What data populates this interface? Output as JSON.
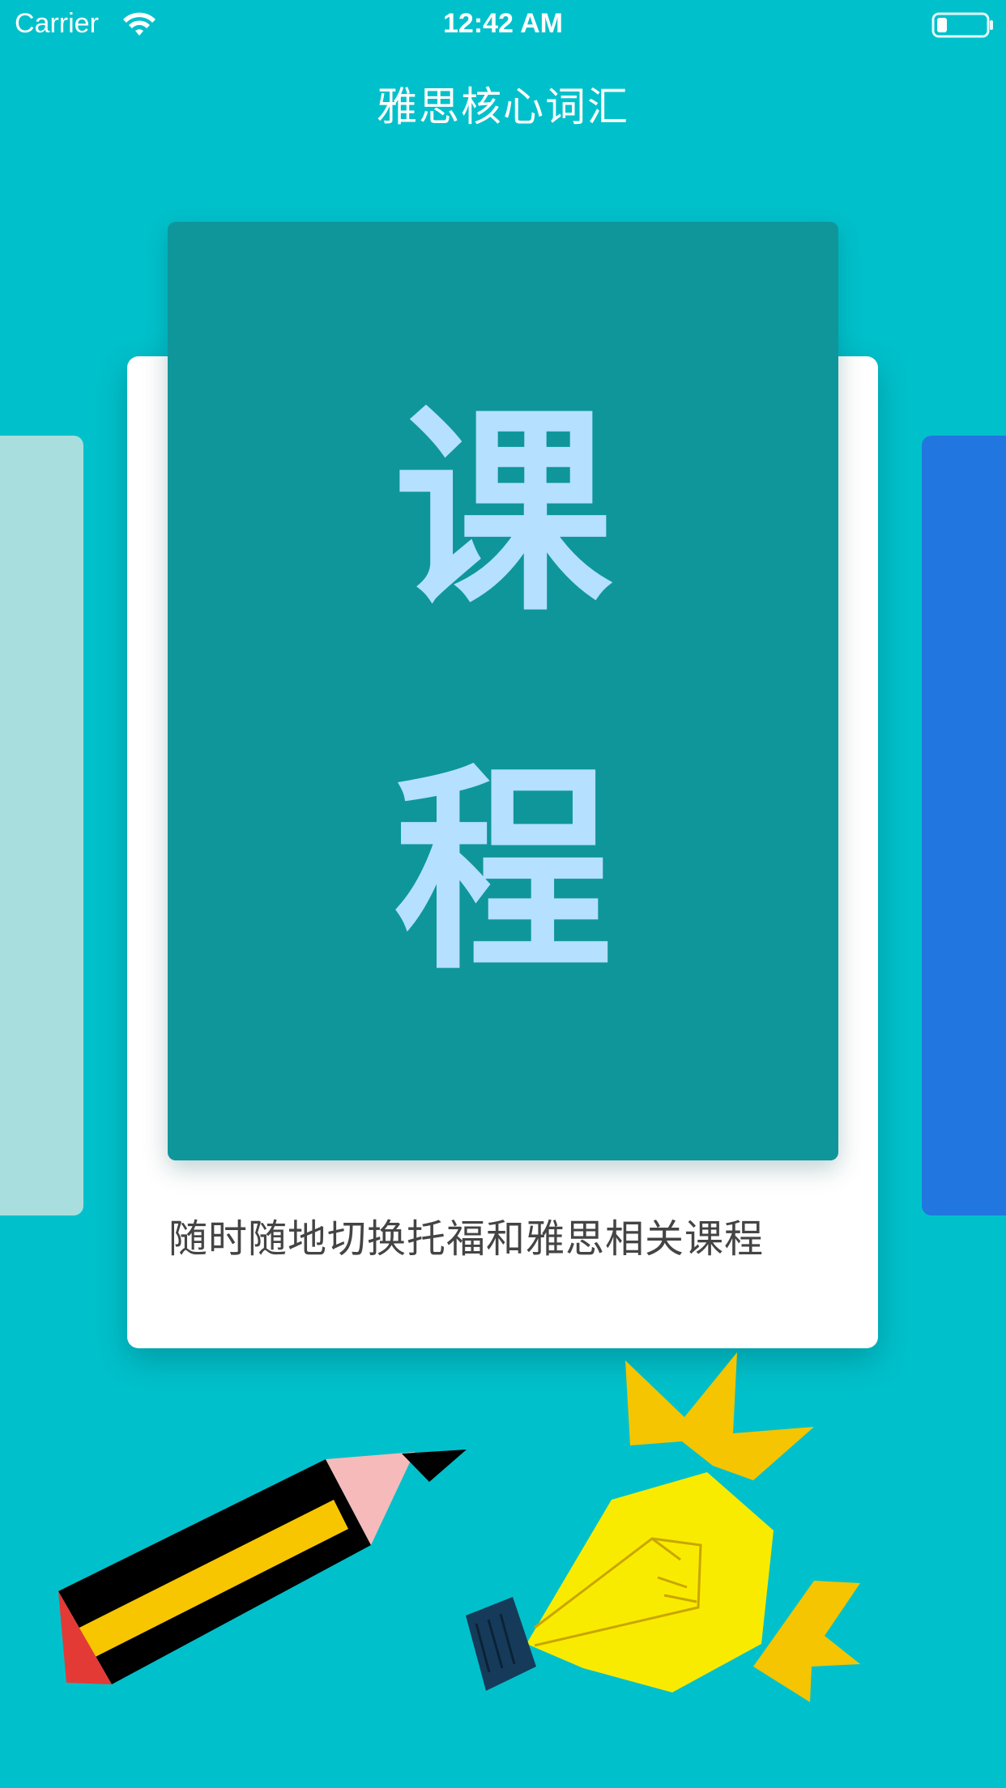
{
  "status_bar": {
    "carrier": "Carrier",
    "time": "12:42 AM",
    "wifi_icon": "wifi-icon",
    "battery_icon": "battery-low-icon"
  },
  "nav": {
    "title": "雅思核心词汇"
  },
  "carousel": {
    "current_card": {
      "cover_glyph_top": "课",
      "cover_glyph_bottom": "程",
      "caption": "随时随地切换托福和雅思相关课程"
    }
  },
  "colors": {
    "background": "#00C1CB",
    "cover": "#0E969B",
    "cover_glyph": "#B5E0FF",
    "left_card": "#A8DEDD",
    "right_card": "#2276E0"
  },
  "illustrations": [
    "pencil-illustration",
    "light-bulb-illustration"
  ]
}
